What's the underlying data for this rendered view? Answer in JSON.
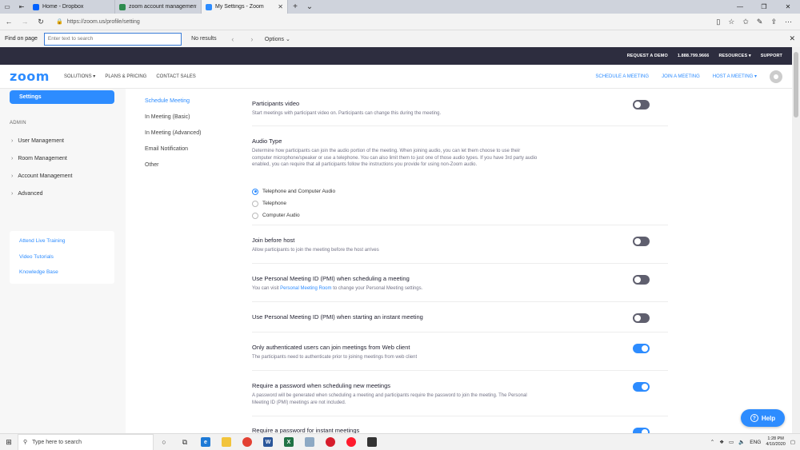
{
  "browser": {
    "tabs": [
      {
        "title": "Home - Dropbox",
        "color": "#0061fe"
      },
      {
        "title": "zoom account management",
        "color": "#2d8c4e"
      },
      {
        "title": "My Settings - Zoom",
        "color": "#2d8cff",
        "active": true
      }
    ],
    "url": "https://zoom.us/profile/setting",
    "find": {
      "label": "Find on page",
      "placeholder": "Enter text to search",
      "result": "No results",
      "options": "Options"
    }
  },
  "zoom": {
    "top": [
      "REQUEST A DEMO",
      "1.888.799.9666",
      "RESOURCES ▾",
      "SUPPORT"
    ],
    "logo": "zoom",
    "nav": [
      "SOLUTIONS ▾",
      "PLANS & PRICING",
      "CONTACT SALES"
    ],
    "nav_right": [
      "SCHEDULE A MEETING",
      "JOIN A MEETING",
      "HOST A MEETING ▾"
    ]
  },
  "sidebar": {
    "active": "Settings",
    "admin_title": "ADMIN",
    "items": [
      "User Management",
      "Room Management",
      "Account Management",
      "Advanced"
    ],
    "help_links": [
      "Attend Live Training",
      "Video Tutorials",
      "Knowledge Base"
    ]
  },
  "subnav": [
    "Schedule Meeting",
    "In Meeting (Basic)",
    "In Meeting (Advanced)",
    "Email Notification",
    "Other"
  ],
  "settings": {
    "participants_video": {
      "title": "Participants video",
      "desc": "Start meetings with participant video on. Participants can change this during the meeting.",
      "enabled": false
    },
    "audio_type": {
      "title": "Audio Type",
      "desc": "Determine how participants can join the audio portion of the meeting. When joining audio, you can let them choose to use their computer microphone/speaker or use a telephone. You can also limit them to just one of those audio types. If you have 3rd party audio enabled, you can require that all participants follow the instructions you provide for using non-Zoom audio.",
      "options": [
        "Telephone and Computer Audio",
        "Telephone",
        "Computer Audio"
      ],
      "selected": "Telephone and Computer Audio"
    },
    "join_before_host": {
      "title": "Join before host",
      "desc": "Allow participants to join the meeting before the host arrives",
      "enabled": false
    },
    "pmi_scheduling": {
      "title": "Use Personal Meeting ID (PMI) when scheduling a meeting",
      "desc_pre": "You can visit",
      "desc_link": "Personal Meeting Room",
      "desc_post": "to change your Personal Meeting settings.",
      "enabled": false
    },
    "pmi_instant": {
      "title": "Use Personal Meeting ID (PMI) when starting an instant meeting",
      "enabled": false
    },
    "auth_users": {
      "title": "Only authenticated users can join meetings from Web client",
      "desc": "The participants need to authenticate prior to joining meetings from web client",
      "enabled": true
    },
    "password_scheduling": {
      "title": "Require a password when scheduling new meetings",
      "desc": "A password will be generated when scheduling a meeting and participants require the password to join the meeting. The Personal Meeting ID (PMI) meetings are not included.",
      "enabled": true
    },
    "password_instant": {
      "title": "Require a password for instant meetings",
      "enabled": true
    }
  },
  "help_button": "Help",
  "taskbar": {
    "search_placeholder": "Type here to search",
    "lang": "ENG",
    "time": "1:28 PM",
    "date": "4/10/2020"
  }
}
